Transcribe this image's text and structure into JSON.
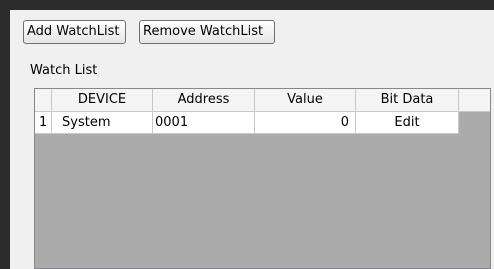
{
  "toolbar": {
    "add_label": "Add WatchList",
    "remove_label": "Remove WatchList"
  },
  "watch_list": {
    "title": "Watch List",
    "columns": [
      "",
      "DEVICE",
      "Address",
      "Value",
      "Bit Data"
    ],
    "rows": [
      {
        "index": "1",
        "device": "System",
        "address": "0001",
        "value": "0",
        "bit_data": "Edit"
      }
    ]
  }
}
